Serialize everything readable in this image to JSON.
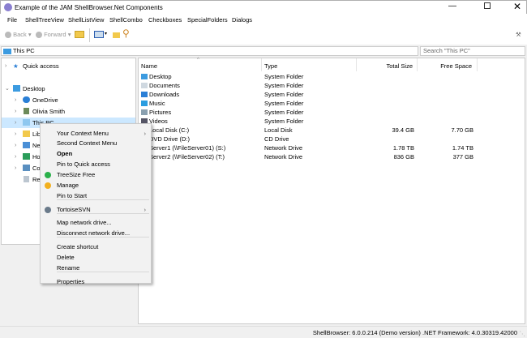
{
  "window": {
    "title": "Example of the JAM ShellBrowser.Net Components"
  },
  "menu": [
    "File",
    "ShellTreeView",
    "ShellListView",
    "ShellCombo",
    "Checkboxes",
    "SpecialFolders",
    "Dialogs"
  ],
  "toolbar": {
    "back": "Back",
    "forward": "Forward"
  },
  "address": {
    "value": "This PC"
  },
  "search": {
    "placeholder": "Search \"This PC\""
  },
  "tree": {
    "quick_access": "Quick access",
    "desktop": "Desktop",
    "items": [
      "OneDrive",
      "Olivia Smith",
      "This PC",
      "Libraries",
      "Network",
      "Homegroup",
      "Control Panel",
      "Recycle Bin"
    ]
  },
  "list": {
    "columns": [
      "Name",
      "Type",
      "Total Size",
      "Free Space"
    ],
    "rows": [
      {
        "name": "Desktop",
        "type": "System Folder",
        "total": "",
        "free": ""
      },
      {
        "name": "Documents",
        "type": "System Folder",
        "total": "",
        "free": ""
      },
      {
        "name": "Downloads",
        "type": "System Folder",
        "total": "",
        "free": ""
      },
      {
        "name": "Music",
        "type": "System Folder",
        "total": "",
        "free": ""
      },
      {
        "name": "Pictures",
        "type": "System Folder",
        "total": "",
        "free": ""
      },
      {
        "name": "Videos",
        "type": "System Folder",
        "total": "",
        "free": ""
      },
      {
        "name": "Local Disk (C:)",
        "type": "Local Disk",
        "total": "39.4 GB",
        "free": "7.70 GB"
      },
      {
        "name": "DVD Drive (D:)",
        "type": "CD Drive",
        "total": "",
        "free": ""
      },
      {
        "name": "Server1 (\\\\FileServer01) (S:)",
        "type": "Network Drive",
        "total": "1.78 TB",
        "free": "1.74 TB"
      },
      {
        "name": "Server2 (\\\\FileServer02) (T:)",
        "type": "Network Drive",
        "total": "836 GB",
        "free": "377 GB"
      }
    ]
  },
  "context_menu": {
    "items": [
      "Your Context Menu",
      "Second Context Menu",
      "Open",
      "Pin to Quick access",
      "TreeSize Free",
      "Manage",
      "Pin to Start",
      "TortoiseSVN",
      "Map network drive...",
      "Disconnect network drive...",
      "Create shortcut",
      "Delete",
      "Rename",
      "Properties"
    ]
  },
  "status": {
    "text": "ShellBrowser: 6.0.0.214 (Demo version) .NET Framework: 4.0.30319.42000"
  }
}
